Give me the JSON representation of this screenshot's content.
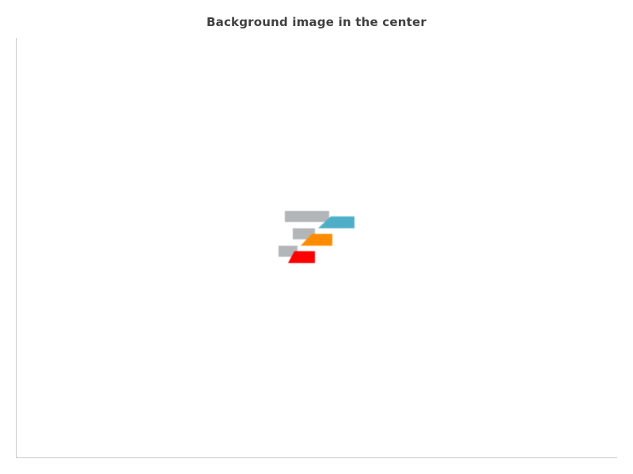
{
  "chart_data": {
    "type": "bar",
    "title": "Background image in the center",
    "categories": [],
    "values": [],
    "xlabel": "",
    "ylabel": "",
    "grid": false,
    "legend": "none",
    "background_image": "logo-icon"
  },
  "colors": {
    "title": "#404040",
    "axis": "#c8c8c8",
    "logo_gray": "#b3b6b9",
    "logo_teal": "#4eaec8",
    "logo_orange": "#ff8c00",
    "logo_red": "#ff0000"
  }
}
